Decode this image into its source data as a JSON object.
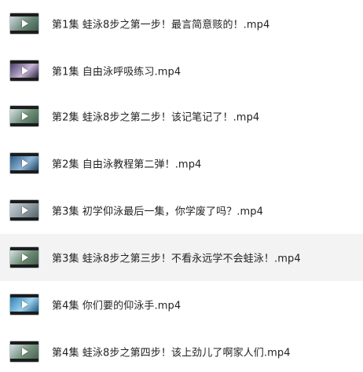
{
  "files": [
    {
      "name": "第1集  蛙泳8步之第一步！最言简意赅的！.mp4",
      "thumb_colors": [
        "#cfd8dc",
        "#6d8a7a",
        "#3c5a4a"
      ],
      "highlighted": false
    },
    {
      "name": "第1集  自由泳呼吸练习.mp4",
      "thumb_colors": [
        "#4a3f66",
        "#c9b6d8",
        "#2b2440"
      ],
      "highlighted": false
    },
    {
      "name": "第2集  蛙泳8步之第二步！该记笔记了！.mp4",
      "thumb_colors": [
        "#d7e2e8",
        "#6f8f78",
        "#43614d"
      ],
      "highlighted": false
    },
    {
      "name": "第2集  自由泳教程第二弹！.mp4",
      "thumb_colors": [
        "#2d5c86",
        "#8fb6d6",
        "#1d3e5c"
      ],
      "highlighted": false
    },
    {
      "name": "第3集  初学仰泳最后一集，你学废了吗？.mp4",
      "thumb_colors": [
        "#c8d2d8",
        "#8e9ba2",
        "#556168"
      ],
      "highlighted": false
    },
    {
      "name": "第3集  蛙泳8步之第三步！不看永远学不会蛙泳！.mp4",
      "thumb_colors": [
        "#d9e3e7",
        "#6c8c73",
        "#445f4b"
      ],
      "highlighted": true
    },
    {
      "name": "第4集  你们要的仰泳手.mp4",
      "thumb_colors": [
        "#2f7fb3",
        "#9cd2ee",
        "#1c5880"
      ],
      "highlighted": false
    },
    {
      "name": "第4集  蛙泳8步之第四步！该上劲儿了啊家人们.mp4",
      "thumb_colors": [
        "#d4dee4",
        "#75937c",
        "#48634f"
      ],
      "highlighted": false
    }
  ]
}
